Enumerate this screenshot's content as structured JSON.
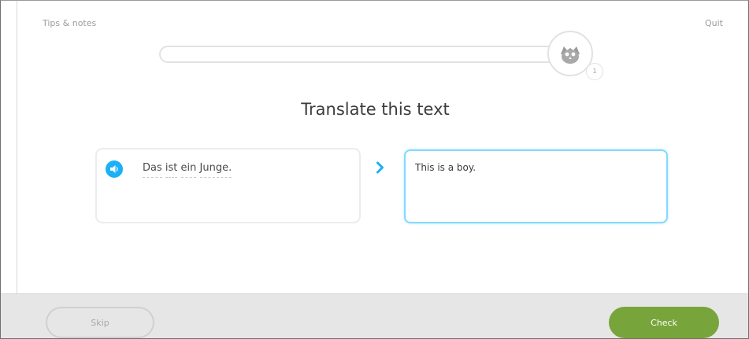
{
  "header": {
    "tips_label": "Tips & notes",
    "quit_label": "Quit"
  },
  "progress": {
    "fraction": 0,
    "badge_icon": "owl-icon",
    "badge_count": "1"
  },
  "challenge": {
    "title": "Translate this text",
    "source_words": [
      "Das",
      "ist",
      "ein",
      "Junge."
    ],
    "speaker_icon": "speaker-icon",
    "arrow_icon": "chevron-right-icon",
    "answer_value": "This is a boy."
  },
  "footer": {
    "skip_label": "Skip",
    "check_label": "Check"
  },
  "colors": {
    "accent_blue": "#1cb0f6",
    "check_green": "#78a53b",
    "progress_yellow": "#f3c13d"
  }
}
